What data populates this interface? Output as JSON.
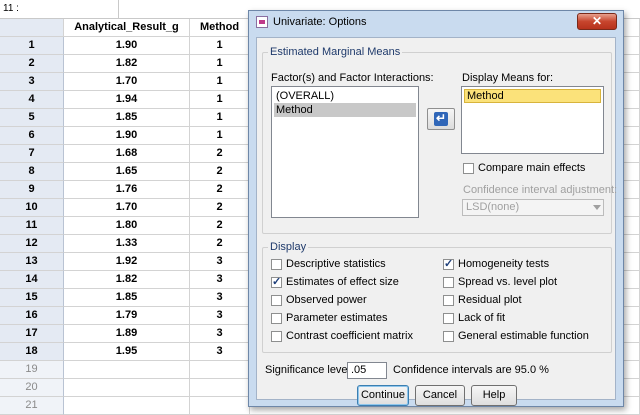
{
  "cell_ref": "11 :",
  "grid": {
    "columns": [
      "Analytical_Result_g",
      "Method"
    ],
    "rows": [
      {
        "n": "1",
        "res": "1.90",
        "meth": "1"
      },
      {
        "n": "2",
        "res": "1.82",
        "meth": "1"
      },
      {
        "n": "3",
        "res": "1.70",
        "meth": "1"
      },
      {
        "n": "4",
        "res": "1.94",
        "meth": "1"
      },
      {
        "n": "5",
        "res": "1.85",
        "meth": "1"
      },
      {
        "n": "6",
        "res": "1.90",
        "meth": "1"
      },
      {
        "n": "7",
        "res": "1.68",
        "meth": "2"
      },
      {
        "n": "8",
        "res": "1.65",
        "meth": "2"
      },
      {
        "n": "9",
        "res": "1.76",
        "meth": "2"
      },
      {
        "n": "10",
        "res": "1.70",
        "meth": "2"
      },
      {
        "n": "11",
        "res": "1.80",
        "meth": "2"
      },
      {
        "n": "12",
        "res": "1.33",
        "meth": "2"
      },
      {
        "n": "13",
        "res": "1.92",
        "meth": "3"
      },
      {
        "n": "14",
        "res": "1.82",
        "meth": "3"
      },
      {
        "n": "15",
        "res": "1.85",
        "meth": "3"
      },
      {
        "n": "16",
        "res": "1.79",
        "meth": "3"
      },
      {
        "n": "17",
        "res": "1.89",
        "meth": "3"
      },
      {
        "n": "18",
        "res": "1.95",
        "meth": "3"
      },
      {
        "n": "19",
        "res": "",
        "meth": ""
      },
      {
        "n": "20",
        "res": "",
        "meth": ""
      },
      {
        "n": "21",
        "res": "",
        "meth": ""
      }
    ]
  },
  "dialog": {
    "title": "Univariate: Options",
    "close_label": "✕",
    "emm": {
      "legend": "Estimated Marginal Means",
      "factors_label": "Factor(s) and Factor Interactions:",
      "factors": [
        "(OVERALL)",
        "Method"
      ],
      "display_label": "Display Means for:",
      "display_items": [
        "Method"
      ],
      "arrow_icon": "arrow-left-icon",
      "compare_label": "Compare main effects",
      "compare_checked": false,
      "ci_adjust_label": "Confidence interval adjustment:",
      "ci_adjust_value": "LSD(none)"
    },
    "display": {
      "legend": "Display",
      "options": [
        {
          "label": "Descriptive statistics",
          "checked": false
        },
        {
          "label": "Estimates of effect size",
          "checked": true
        },
        {
          "label": "Observed power",
          "checked": false
        },
        {
          "label": "Parameter estimates",
          "checked": false
        },
        {
          "label": "Contrast coefficient matrix",
          "checked": false
        },
        {
          "label": "Homogeneity tests",
          "checked": true
        },
        {
          "label": "Spread vs. level plot",
          "checked": false
        },
        {
          "label": "Residual plot",
          "checked": false
        },
        {
          "label": "Lack of fit",
          "checked": false
        },
        {
          "label": "General estimable function",
          "checked": false
        }
      ]
    },
    "significance_label": "Significance level:",
    "significance_value": ".05",
    "ci_text": "Confidence intervals are 95.0 %",
    "buttons": {
      "continue": "Continue",
      "cancel": "Cancel",
      "help": "Help"
    }
  }
}
